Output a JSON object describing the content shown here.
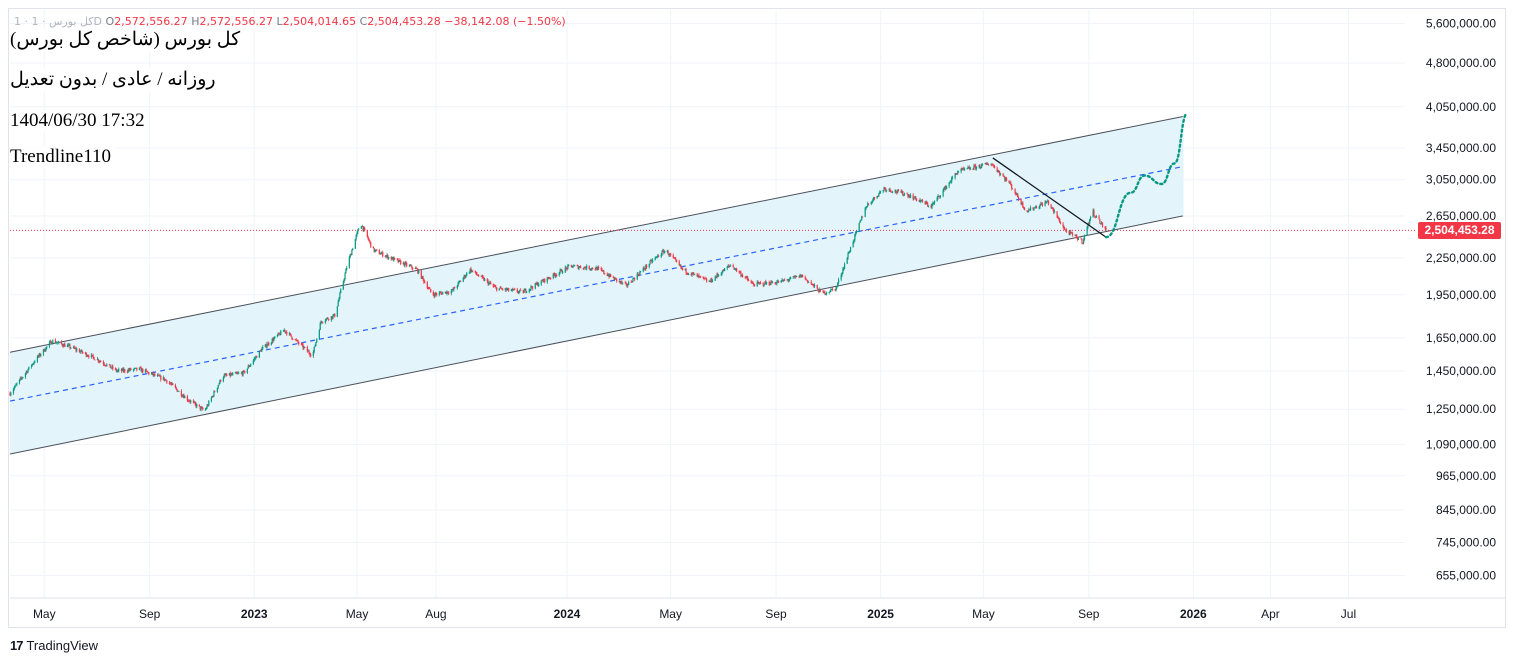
{
  "legend": {
    "symbol": "1 · كل بورس · 1D",
    "open_label": "O",
    "open": "2,572,556.27",
    "high_label": "H",
    "high": "2,572,556.27",
    "low_label": "L",
    "low": "2,504,014.65",
    "close_label": "C",
    "close": "2,504,453.28",
    "change": "−38,142.08 (−1.50%)"
  },
  "notes": {
    "title": "کل بورس (شاخص کل بورس)",
    "subtitle": "روزانه / عادی / بدون تعدیل",
    "datetime": "1404/06/30 17:32",
    "tag": "Trendline110"
  },
  "brand": {
    "name": "TradingView"
  },
  "colors": {
    "up": "#089981",
    "down": "#f23645",
    "channel_fill": "#e3f4fb",
    "channel_line": "#4a4f5a",
    "mid_line": "#2962ff",
    "projection": "#089981",
    "price_line": "#f23645",
    "grid": "#f0f3fa",
    "axis_text": "#131722"
  },
  "chart_data": {
    "type": "line",
    "series_style": "candlestick",
    "y_scale": "log",
    "ylim": [
      600000,
      5900000
    ],
    "xlim": [
      "2022-03-22",
      "2026-09-05"
    ],
    "current_price": 2504453.28,
    "current_price_label": "2,504,453.28",
    "y_ticks": [
      {
        "value": 5600000,
        "label": "5,600,000.00"
      },
      {
        "value": 4800000,
        "label": "4,800,000.00"
      },
      {
        "value": 4050000,
        "label": "4,050,000.00"
      },
      {
        "value": 3450000,
        "label": "3,450,000.00"
      },
      {
        "value": 3050000,
        "label": "3,050,000.00"
      },
      {
        "value": 2650000,
        "label": "2,650,000.00"
      },
      {
        "value": 2250000,
        "label": "2,250,000.00"
      },
      {
        "value": 1950000,
        "label": "1,950,000.00"
      },
      {
        "value": 1650000,
        "label": "1,650,000.00"
      },
      {
        "value": 1450000,
        "label": "1,450,000.00"
      },
      {
        "value": 1250000,
        "label": "1,250,000.00"
      },
      {
        "value": 1090000,
        "label": "1,090,000.00"
      },
      {
        "value": 965000,
        "label": "965,000.00"
      },
      {
        "value": 845000,
        "label": "845,000.00"
      },
      {
        "value": 745000,
        "label": "745,000.00"
      },
      {
        "value": 655000,
        "label": "655,000.00"
      }
    ],
    "x_ticks": [
      {
        "date": "2022-05-01",
        "label": "May",
        "bold": false
      },
      {
        "date": "2022-09-01",
        "label": "Sep",
        "bold": false
      },
      {
        "date": "2023-01-01",
        "label": "2023",
        "bold": true
      },
      {
        "date": "2023-05-01",
        "label": "May",
        "bold": false
      },
      {
        "date": "2023-08-01",
        "label": "Aug",
        "bold": false
      },
      {
        "date": "2024-01-01",
        "label": "2024",
        "bold": true
      },
      {
        "date": "2024-05-01",
        "label": "May",
        "bold": false
      },
      {
        "date": "2024-09-01",
        "label": "Sep",
        "bold": false
      },
      {
        "date": "2025-01-01",
        "label": "2025",
        "bold": true
      },
      {
        "date": "2025-05-01",
        "label": "May",
        "bold": false
      },
      {
        "date": "2025-09-01",
        "label": "Sep",
        "bold": false
      },
      {
        "date": "2026-01-01",
        "label": "2026",
        "bold": true
      },
      {
        "date": "2026-04-01",
        "label": "Apr",
        "bold": false
      },
      {
        "date": "2026-07-01",
        "label": "Jul",
        "bold": false
      }
    ],
    "price_path": [
      [
        "2022-03-22",
        1330000
      ],
      [
        "2022-04-20",
        1510000
      ],
      [
        "2022-05-10",
        1630000
      ],
      [
        "2022-06-01",
        1590000
      ],
      [
        "2022-07-01",
        1520000
      ],
      [
        "2022-07-25",
        1450000
      ],
      [
        "2022-08-20",
        1460000
      ],
      [
        "2022-09-20",
        1400000
      ],
      [
        "2022-10-15",
        1300000
      ],
      [
        "2022-11-04",
        1240000
      ],
      [
        "2022-11-25",
        1420000
      ],
      [
        "2022-12-20",
        1440000
      ],
      [
        "2023-01-10",
        1580000
      ],
      [
        "2023-02-05",
        1700000
      ],
      [
        "2023-02-25",
        1600000
      ],
      [
        "2023-03-10",
        1540000
      ],
      [
        "2023-03-20",
        1760000
      ],
      [
        "2023-04-05",
        1800000
      ],
      [
        "2023-04-20",
        2200000
      ],
      [
        "2023-05-05",
        2580000
      ],
      [
        "2023-05-20",
        2320000
      ],
      [
        "2023-06-15",
        2230000
      ],
      [
        "2023-07-10",
        2150000
      ],
      [
        "2023-07-28",
        1950000
      ],
      [
        "2023-08-20",
        1980000
      ],
      [
        "2023-09-10",
        2150000
      ],
      [
        "2023-10-10",
        2000000
      ],
      [
        "2023-11-10",
        1970000
      ],
      [
        "2023-12-10",
        2080000
      ],
      [
        "2024-01-05",
        2180000
      ],
      [
        "2024-02-05",
        2160000
      ],
      [
        "2024-03-10",
        2020000
      ],
      [
        "2024-04-10",
        2230000
      ],
      [
        "2024-04-25",
        2320000
      ],
      [
        "2024-05-15",
        2150000
      ],
      [
        "2024-06-15",
        2050000
      ],
      [
        "2024-07-10",
        2190000
      ],
      [
        "2024-08-05",
        2030000
      ],
      [
        "2024-09-05",
        2050000
      ],
      [
        "2024-10-01",
        2100000
      ],
      [
        "2024-10-25",
        1960000
      ],
      [
        "2024-11-10",
        2000000
      ],
      [
        "2024-11-25",
        2300000
      ],
      [
        "2024-12-15",
        2750000
      ],
      [
        "2025-01-05",
        2950000
      ],
      [
        "2025-02-01",
        2880000
      ],
      [
        "2025-03-01",
        2750000
      ],
      [
        "2025-04-01",
        3150000
      ],
      [
        "2025-05-10",
        3250000
      ],
      [
        "2025-06-01",
        3000000
      ],
      [
        "2025-06-20",
        2700000
      ],
      [
        "2025-07-15",
        2800000
      ],
      [
        "2025-08-05",
        2500000
      ],
      [
        "2025-08-25",
        2400000
      ],
      [
        "2025-09-05",
        2700000
      ],
      [
        "2025-09-21",
        2504453
      ]
    ],
    "channel": {
      "upper": [
        [
          "2022-03-22",
          1560000
        ],
        [
          "2025-12-20",
          3900000
        ]
      ],
      "lower": [
        [
          "2022-03-22",
          1050000
        ],
        [
          "2025-12-20",
          2650000
        ]
      ],
      "middle": [
        [
          "2022-03-22",
          1290000
        ],
        [
          "2025-12-20",
          3210000
        ]
      ]
    },
    "down_trendline": [
      [
        "2025-05-12",
        3320000
      ],
      [
        "2025-09-21",
        2440000
      ]
    ],
    "projection": [
      [
        "2025-09-21",
        2440000
      ],
      [
        "2025-10-20",
        2900000
      ],
      [
        "2025-11-05",
        3100000
      ],
      [
        "2025-11-25",
        3000000
      ],
      [
        "2025-12-10",
        3250000
      ],
      [
        "2025-12-25",
        3950000
      ]
    ]
  }
}
